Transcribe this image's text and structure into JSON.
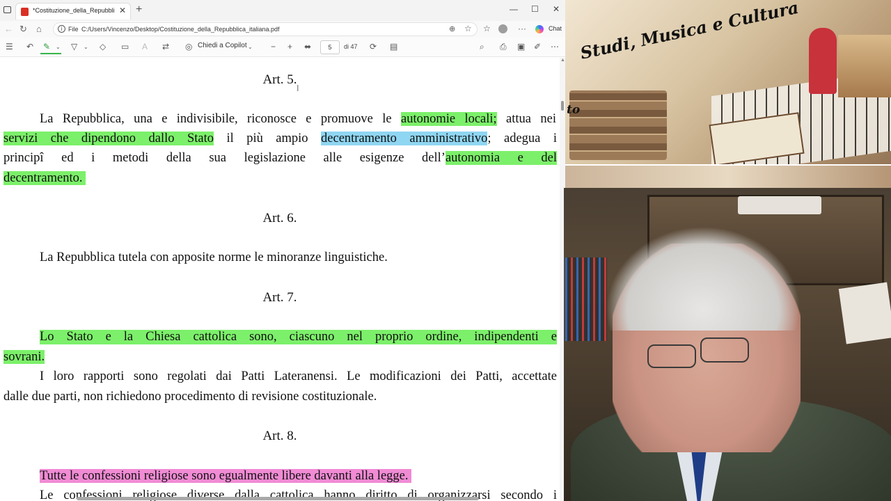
{
  "browser": {
    "tab_title": "*Costituzione_della_Repubblica_italiana.pdf",
    "tab_close": "✕",
    "new_tab": "+",
    "win_minimize": "—",
    "win_maximize": "☐",
    "win_close": "✕",
    "file_label": "File",
    "url": "C:/Users/Vincenzo/Desktop/Costituzione_della_Repubblica_italiana.pdf",
    "chat_label": "Chat",
    "more_label": "···"
  },
  "pdf_toolbar": {
    "copilot_label": "Chiedi a Copilot",
    "page_current": "5",
    "page_total": "di 47",
    "zoom_out": "−",
    "zoom_in": "+"
  },
  "document": {
    "art5": {
      "heading": "Art. 5.",
      "l1_a": "La Repubblica, una e indivisibile, riconosce e promuove le ",
      "l1_hl": "autonomie locali;",
      "l1_b": " attua nei",
      "l2_hl1": "servizi che dipendono dallo Stato",
      "l2_a": " il più ampio ",
      "l2_hl2": "decentramento amministrativo",
      "l2_b": "; adegua i",
      "l3_a": "principî ed i metodi della sua legislazione alle esigenze dell’",
      "l3_hl": "autonomia e del",
      "l4_hl": "decentramento. "
    },
    "art6": {
      "heading": "Art. 6.",
      "l1": "La Repubblica tutela con apposite norme le minoranze linguistiche."
    },
    "art7": {
      "heading": "Art. 7.",
      "l1_hl": "Lo Stato e la Chiesa cattolica sono, ciascuno nel proprio ordine, indipendenti e",
      "l2_hl": "sovrani.",
      "l3": "I loro rapporti sono regolati dai Patti Lateranensi. Le modificazioni dei Patti, accettate",
      "l4": "dalle due parti, non richiedono procedimento di revisione costituzionale."
    },
    "art8": {
      "heading": "Art. 8.",
      "l1_hl": "Tutte le confessioni religiose sono egualmente libere davanti alla legge. ",
      "l2": "Le confessioni religiose diverse dalla cattolica hanno diritto di organizzarsi secondo i"
    }
  },
  "banner": {
    "title": "Studi, Musica e Cultura",
    "partial_text": "to"
  },
  "colors": {
    "highlight_green": "#7cf06a",
    "highlight_blue": "#8fd6f2",
    "highlight_pink": "#f08bd4"
  }
}
